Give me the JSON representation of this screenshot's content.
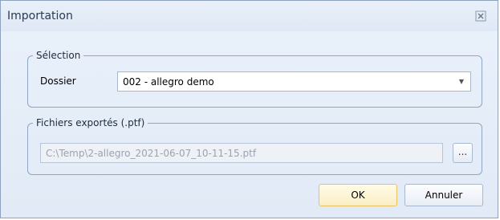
{
  "window": {
    "title": "Importation"
  },
  "selection": {
    "legend": "Sélection",
    "folder_label": "Dossier",
    "folder_value": "002 - allegro demo"
  },
  "exported": {
    "legend": "Fichiers exportés (.ptf)",
    "path_value": "C:\\Temp\\2-allegro_2021-06-07_10-11-15.ptf",
    "browse_label": "..."
  },
  "buttons": {
    "ok_label": "OK",
    "cancel_label": "Annuler"
  },
  "icons": {
    "close": "close-icon",
    "dropdown": "chevron-down-icon"
  }
}
